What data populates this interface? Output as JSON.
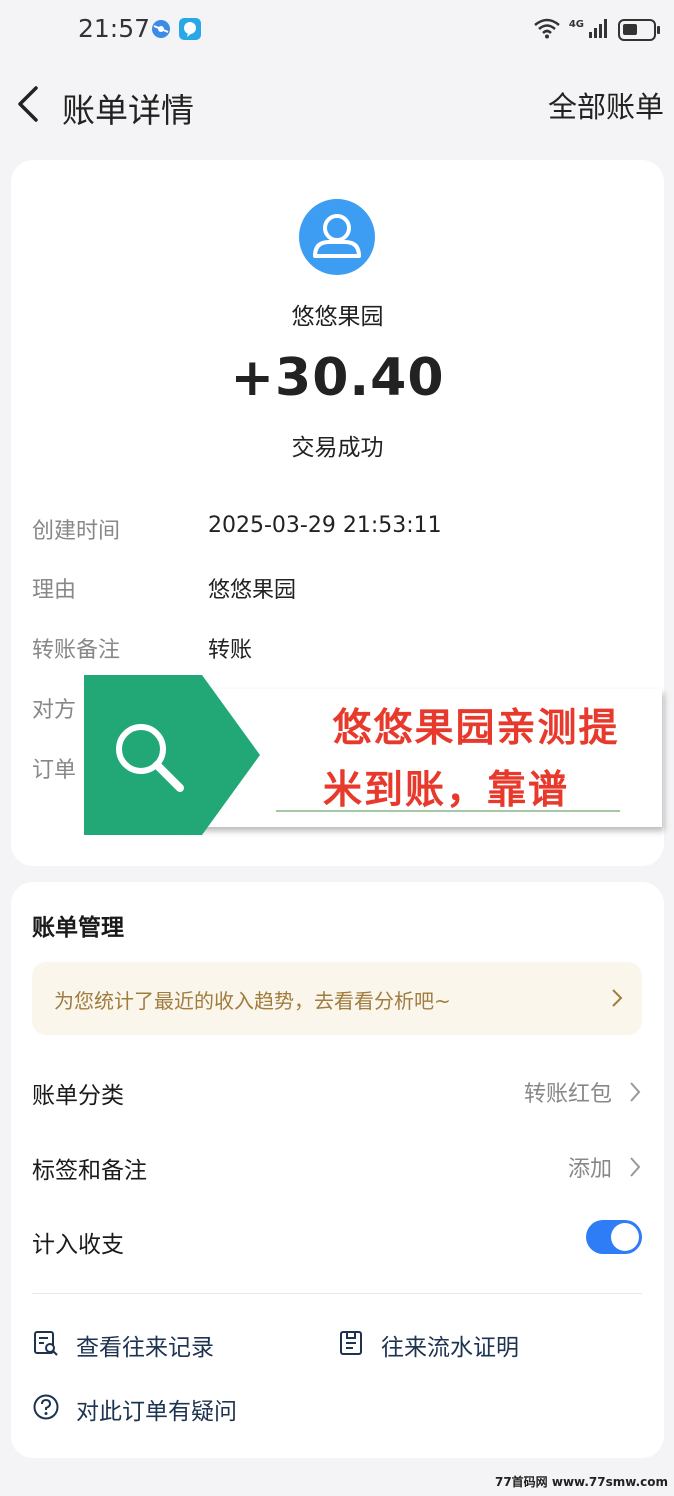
{
  "status_bar": {
    "time": "21:57",
    "network_label": "4G",
    "icons": [
      "browser-icon",
      "chat-app-icon",
      "wifi-icon",
      "signal-icon",
      "battery-icon"
    ]
  },
  "nav": {
    "title": "账单详情",
    "right_link": "全部账单"
  },
  "transaction": {
    "merchant": "悠悠果园",
    "amount": "+30.40",
    "status": "交易成功",
    "details": [
      {
        "label": "创建时间",
        "value": "2025-03-29 21:53:11"
      },
      {
        "label": "理由",
        "value": "悠悠果园"
      },
      {
        "label": "转账备注",
        "value": "转账"
      },
      {
        "label": "对方",
        "value": ""
      },
      {
        "label": "订单",
        "value": ""
      }
    ]
  },
  "overlay": {
    "line1": "悠悠果园亲测提",
    "line2": "米到账，靠谱",
    "icon": "search-icon",
    "color": "#22a877"
  },
  "management": {
    "title": "账单管理",
    "promo": "为您统计了最近的收入趋势，去看看分析吧~",
    "category": {
      "label": "账单分类",
      "value": "转账红包"
    },
    "tags": {
      "label": "标签和备注",
      "value": "添加"
    },
    "include": {
      "label": "计入收支",
      "enabled": true
    },
    "actions": {
      "history": "查看往来记录",
      "proof": "往来流水证明",
      "question": "对此订单有疑问"
    }
  },
  "watermark": "77首码网 www.77smw.com",
  "colors": {
    "accent": "#2e7cf6",
    "avatar": "#3d9df3",
    "promo_text": "#a07d3e",
    "overlay_text": "#e83a2c"
  }
}
